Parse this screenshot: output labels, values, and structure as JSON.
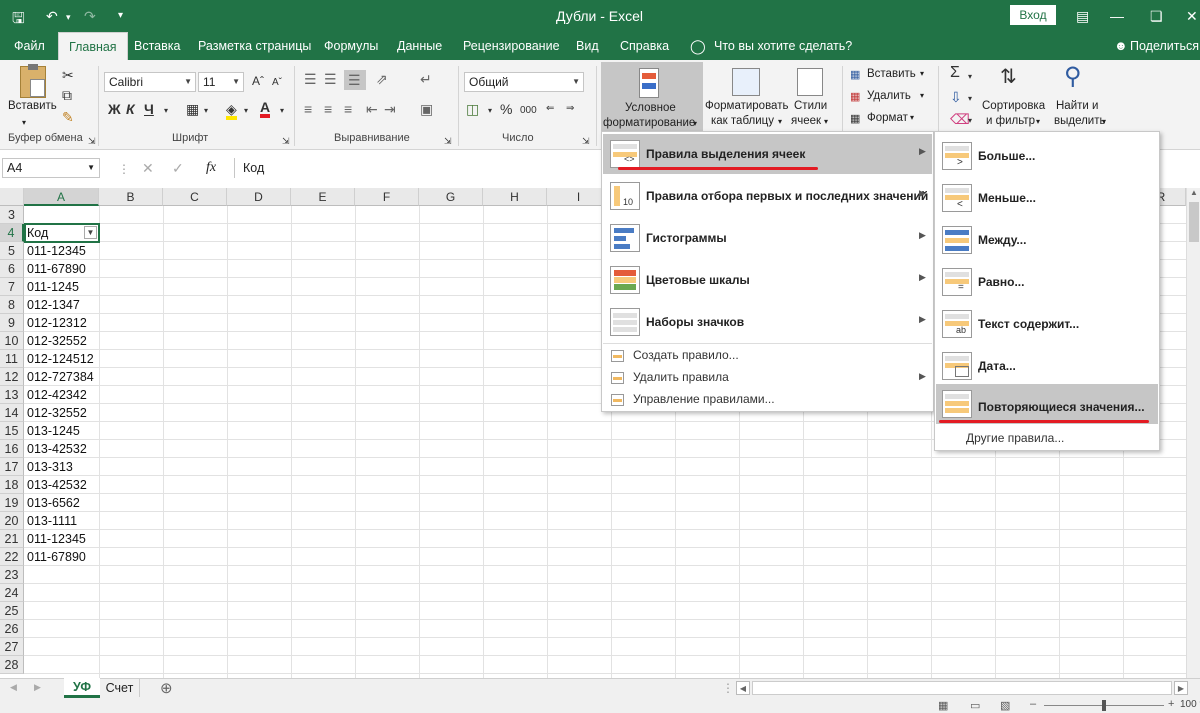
{
  "title_bar": {
    "title": "Дубли  -  Excel",
    "login_label": "Вход"
  },
  "tabs": [
    "Файл",
    "Главная",
    "Вставка",
    "Разметка страницы",
    "Формулы",
    "Данные",
    "Рецензирование",
    "Вид",
    "Справка"
  ],
  "tell_me": "Что вы хотите сделать?",
  "share_label": "Поделиться",
  "ribbon": {
    "paste_label": "Вставить",
    "font_name": "Calibri",
    "font_size": "11",
    "bold": "Ж",
    "italic": "К",
    "underline": "Ч",
    "number_format": "Общий",
    "percent": "%",
    "thousands": "000",
    "conditional_formatting_1": "Условное",
    "conditional_formatting_2": "форматирование",
    "format_as_table_1": "Форматировать",
    "format_as_table_2": "как таблицу",
    "cell_styles_1": "Стили",
    "cell_styles_2": "ячеек",
    "insert_label": "Вставить",
    "delete_label": "Удалить",
    "format_label": "Формат",
    "sort_1": "Сортировка",
    "sort_2": "и фильтр",
    "find_1": "Найти и",
    "find_2": "выделить",
    "group_labels": {
      "clipboard": "Буфер обмена",
      "font": "Шрифт",
      "alignment": "Выравнивание",
      "number": "Число"
    }
  },
  "formula_bar": {
    "name_box": "A4",
    "fx": "fx",
    "formula": "Код"
  },
  "columns": [
    "A",
    "B",
    "C",
    "D",
    "E",
    "F",
    "G",
    "H",
    "I",
    "R"
  ],
  "rows": [
    "3",
    "4",
    "5",
    "6",
    "7",
    "8",
    "9",
    "10",
    "11",
    "12",
    "13",
    "14",
    "15",
    "16",
    "17",
    "18",
    "19",
    "20",
    "21",
    "22",
    "23",
    "24",
    "25",
    "26",
    "27",
    "28"
  ],
  "cells_a": [
    "",
    "Код",
    "011-12345",
    "011-67890",
    "011-1245",
    "012-1347",
    "012-12312",
    "012-32552",
    "012-124512",
    "012-727384",
    "012-42342",
    "012-32552",
    "013-1245",
    "013-42532",
    "013-313",
    "013-42532",
    "013-6562",
    "013-1111",
    "011-12345",
    "011-67890",
    "",
    "",
    "",
    "",
    "",
    ""
  ],
  "cf_menu": {
    "items": [
      "Правила выделения ячеек",
      "Правила отбора первых и последних значений",
      "Гистограммы",
      "Цветовые шкалы",
      "Наборы значков"
    ],
    "small_items": [
      "Создать правило...",
      "Удалить правила",
      "Управление правилами..."
    ]
  },
  "sub_menu": {
    "items": [
      "Больше...",
      "Меньше...",
      "Между...",
      "Равно...",
      "Текст содержит...",
      "Дата...",
      "Повторяющиеся значения..."
    ],
    "other": "Другие правила...",
    "icon_texts": [
      ">",
      "<",
      "",
      "=",
      "ab",
      "",
      ""
    ]
  },
  "sheets": [
    "УФ",
    "Счет"
  ],
  "zoom": "100 %",
  "colors": {
    "excel_green": "#217346",
    "highlight": "#c6c6c6",
    "underline_red": "#e31b23"
  }
}
